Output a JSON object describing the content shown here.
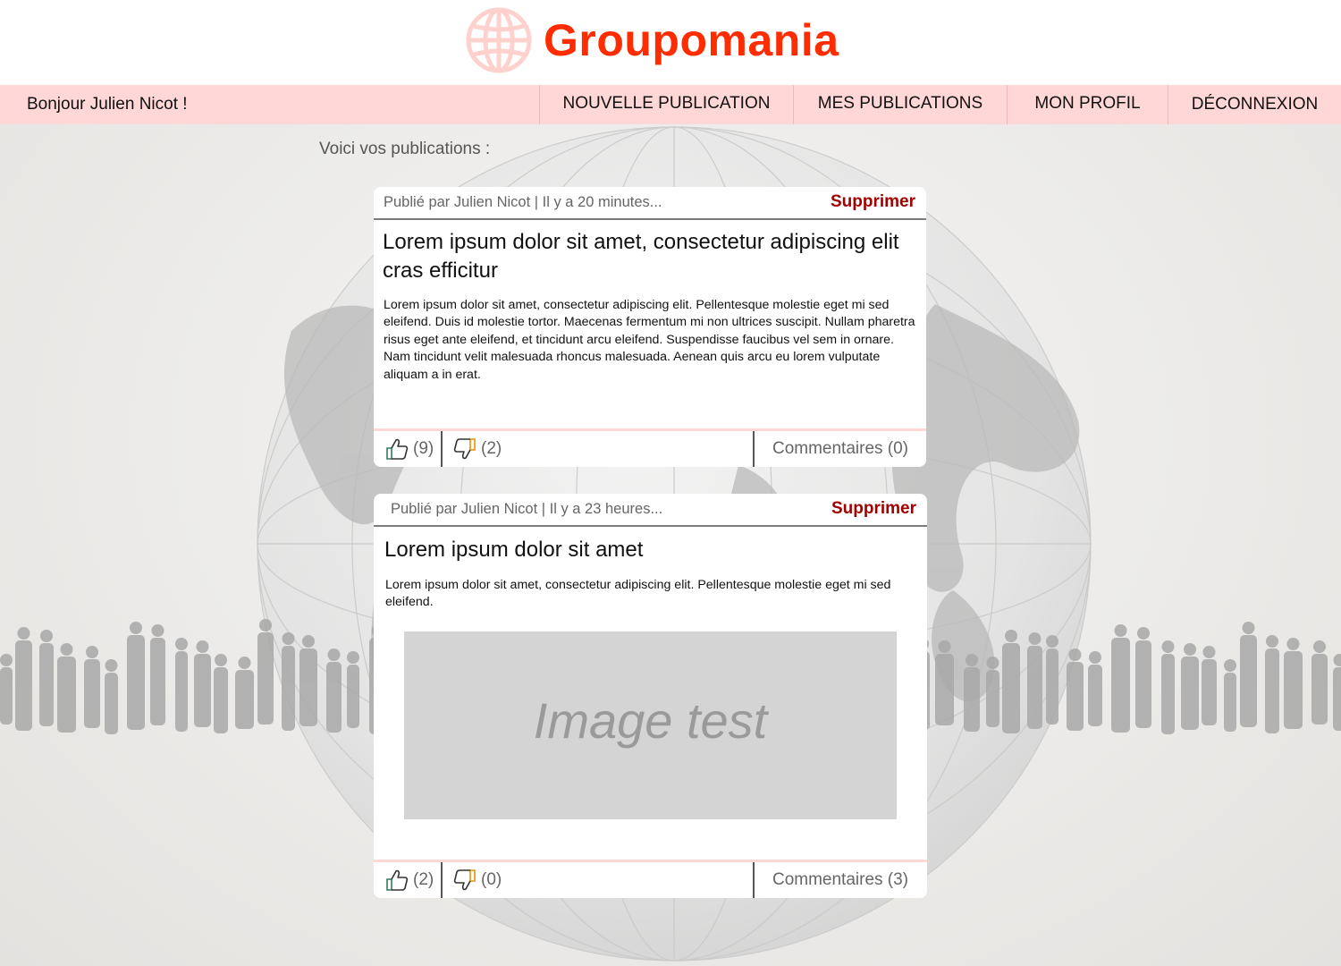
{
  "brand": {
    "name": "Groupomania",
    "icon": "globe-icon",
    "color": "#fd2d01"
  },
  "nav": {
    "greeting": "Bonjour Julien Nicot !",
    "items": [
      "NOUVELLE PUBLICATION",
      "MES PUBLICATIONS",
      "MON PROFIL",
      "DÉCONNEXION"
    ],
    "background": "#ffd7d7"
  },
  "section_title": "Voici vos publications :",
  "posts": [
    {
      "meta": "Publié par Julien Nicot | Il y a 20 minutes...",
      "delete_label": "Supprimer",
      "title": "Lorem ipsum dolor sit amet, consectetur adipiscing elit cras efficitur",
      "body": "Lorem ipsum dolor sit amet, consectetur adipiscing elit. Pellentesque molestie eget mi sed eleifend. Duis id molestie tortor. Maecenas fermentum mi non ultrices suscipit. Nullam pharetra risus eget ante eleifend, et tincidunt arcu eleifend. Suspendisse faucibus vel sem in ornare. Nam tincidunt velit malesuada rhoncus malesuada. Aenean quis arcu eu lorem vulputate aliquam a in erat.",
      "likes": "(9)",
      "dislikes": "(2)",
      "comments": "Commentaires (0)"
    },
    {
      "meta": "Publié par Julien Nicot | Il y a 23 heures...",
      "delete_label": "Supprimer",
      "title": "Lorem ipsum dolor sit amet",
      "body": "Lorem ipsum dolor sit amet, consectetur adipiscing elit. Pellentesque molestie eget mi sed eleifend.",
      "image_text": "Image test",
      "likes": "(2)",
      "dislikes": "(0)",
      "comments": "Commentaires (3)"
    }
  ],
  "icons": {
    "like": "thumbs-up-icon",
    "dislike": "thumbs-down-icon"
  },
  "colors": {
    "delete": "#a30000",
    "nav_bg": "#ffd7d7",
    "brand": "#fd2d01"
  }
}
